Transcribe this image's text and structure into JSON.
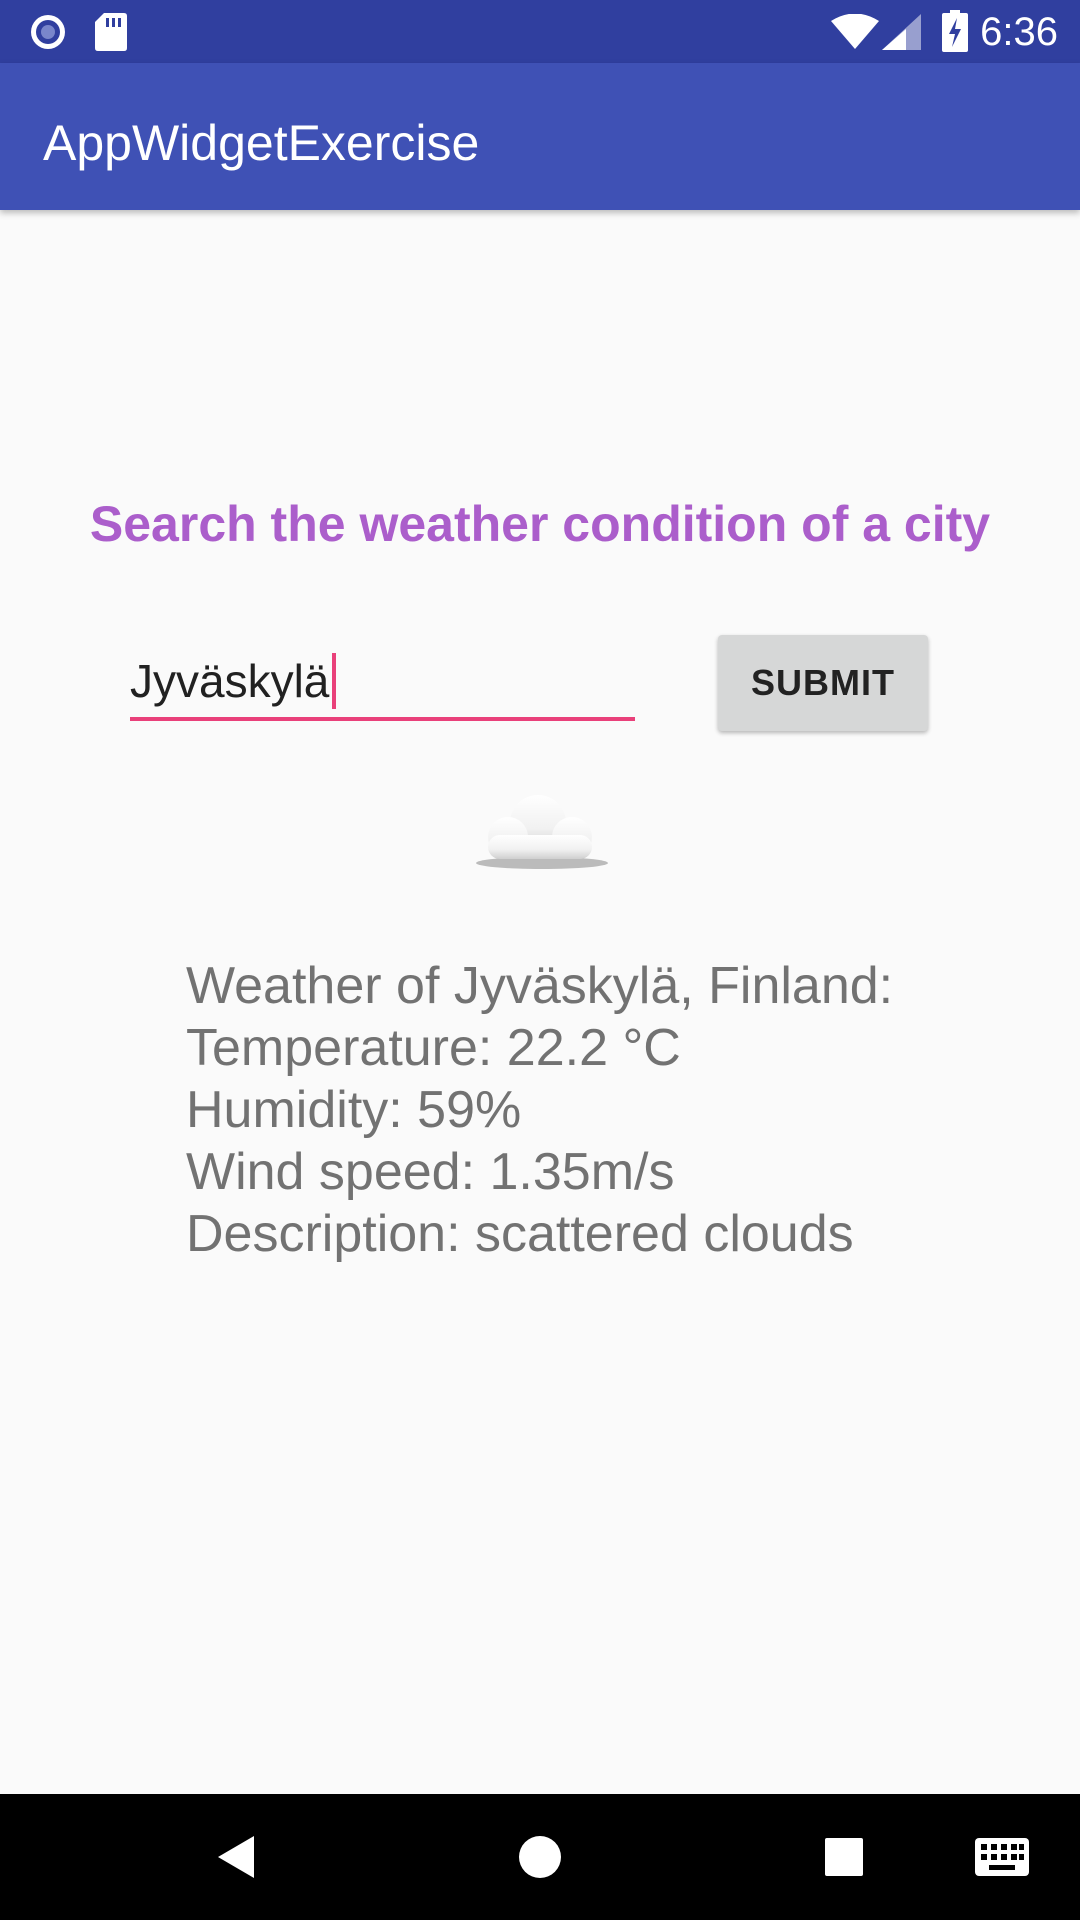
{
  "status_bar": {
    "time": "6:36",
    "icons": [
      "radio-icon",
      "sd-card-icon",
      "wifi-icon",
      "signal-icon",
      "battery-charging-icon"
    ]
  },
  "app_bar": {
    "title": "AppWidgetExercise"
  },
  "main": {
    "heading": "Search the weather condition of a city",
    "city_input": {
      "value": "Jyväskylä"
    },
    "submit_label": "SUBMIT",
    "weather_icon": "cloud-icon",
    "weather": {
      "line1": "Weather of Jyväskylä, Finland:",
      "line2": "Temperature: 22.2 °C",
      "line3": "Humidity: 59%",
      "line4": "Wind speed: 1.35m/s",
      "line5": "Description: scattered clouds"
    }
  },
  "nav_bar": {
    "icons": [
      "back-icon",
      "home-icon",
      "recents-icon",
      "keyboard-icon"
    ]
  },
  "colors": {
    "status_bar": "#303f9f",
    "app_bar": "#3f51b5",
    "heading": "#ab5ecb",
    "accent": "#e9407a",
    "button": "#d6d7d7",
    "weather_text": "#727272"
  }
}
